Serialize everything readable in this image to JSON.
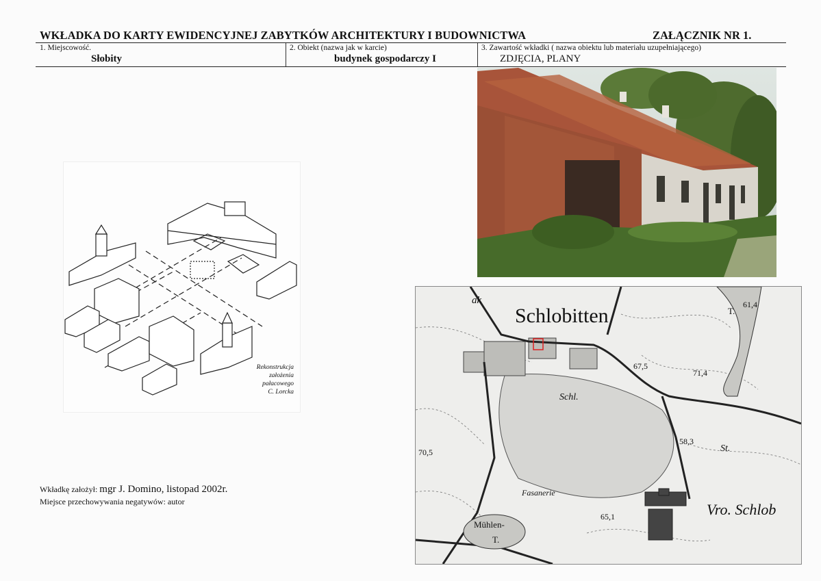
{
  "header": {
    "title": "WKŁADKA DO KARTY EWIDENCYJNEJ ZABYTKÓW ARCHITEKTURY I BUDOWNICTWA",
    "annex": "ZAŁĄCZNIK NR 1."
  },
  "fields": [
    {
      "label": "1.   Miejscowość.",
      "value": "Słobity"
    },
    {
      "label": "2.   Obiekt (nazwa jak w karcie)",
      "value": "budynek gospodarczy I"
    },
    {
      "label": "3.   Zawartość wkładki ( nazwa obiektu lub materiału uzupełniającego)",
      "value": "ZDJĘCIA, PLANY"
    }
  ],
  "drawing": {
    "caption_line1": "Rekonstrukcja",
    "caption_line2": "założenia pałacowego",
    "caption_line3": "C. Lorcka"
  },
  "map": {
    "title": "Schlobitten",
    "labels": [
      "Schl.",
      "St.",
      "Fasanerie",
      "Mühlen-",
      "T.",
      "Vro. Schlob",
      "T.",
      "61,4",
      "67,5",
      "71,4",
      "58,3",
      "70,5",
      "65,1",
      "ak"
    ]
  },
  "footer": {
    "created_label": "Wkładkę założył:",
    "created_value": "mgr J. Domino, listopad 2002r.",
    "storage": "Miejsce przechowywania negatywów: autor"
  }
}
